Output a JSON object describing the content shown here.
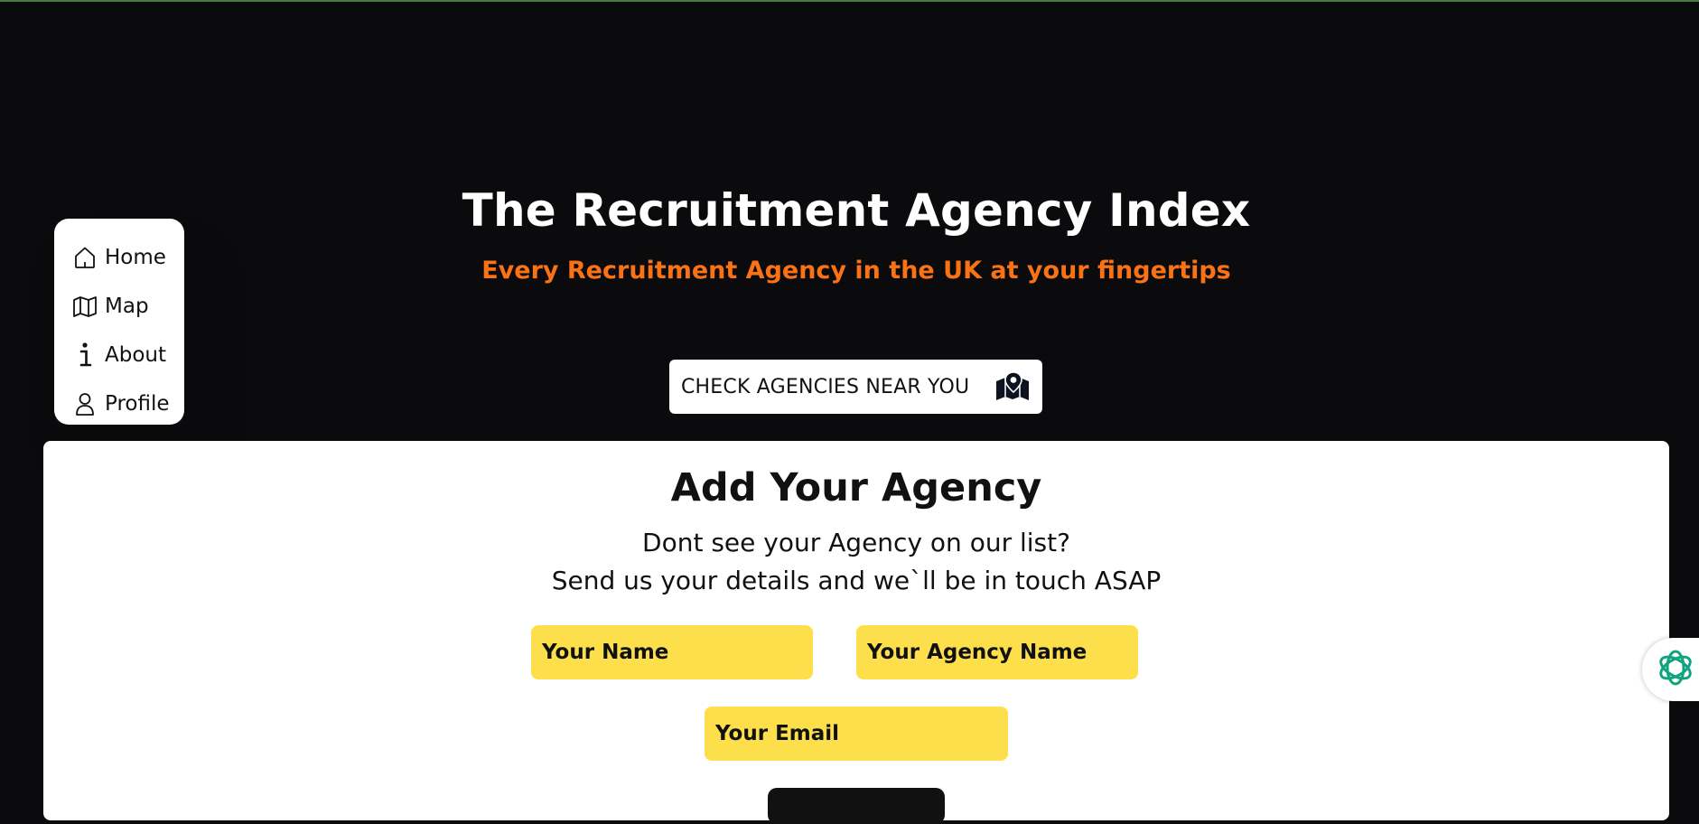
{
  "hero": {
    "title": "The Recruitment Agency Index",
    "subtitle": "Every Recruitment Agency in the UK at your fingertips",
    "subtitle_color": "#f97316"
  },
  "cta": {
    "label": "CHECK AGENCIES NEAR YOU",
    "icon": "map-pin-icon"
  },
  "sidenav": {
    "items": [
      {
        "label": "Home",
        "icon": "home-icon"
      },
      {
        "label": "Map",
        "icon": "map-icon"
      },
      {
        "label": "About",
        "icon": "info-icon"
      },
      {
        "label": "Profile",
        "icon": "user-icon"
      }
    ]
  },
  "form": {
    "title": "Add Your Agency",
    "desc_line1": "Dont see your Agency on our list?",
    "desc_line2": "Send us your details and we`ll be in touch ASAP",
    "name_placeholder": "Your Name",
    "agency_placeholder": "Your Agency Name",
    "email_placeholder": "Your Email",
    "field_color": "#fcdf4a"
  },
  "widget": {
    "icon": "assistant-icon",
    "color": "#10a37f"
  }
}
